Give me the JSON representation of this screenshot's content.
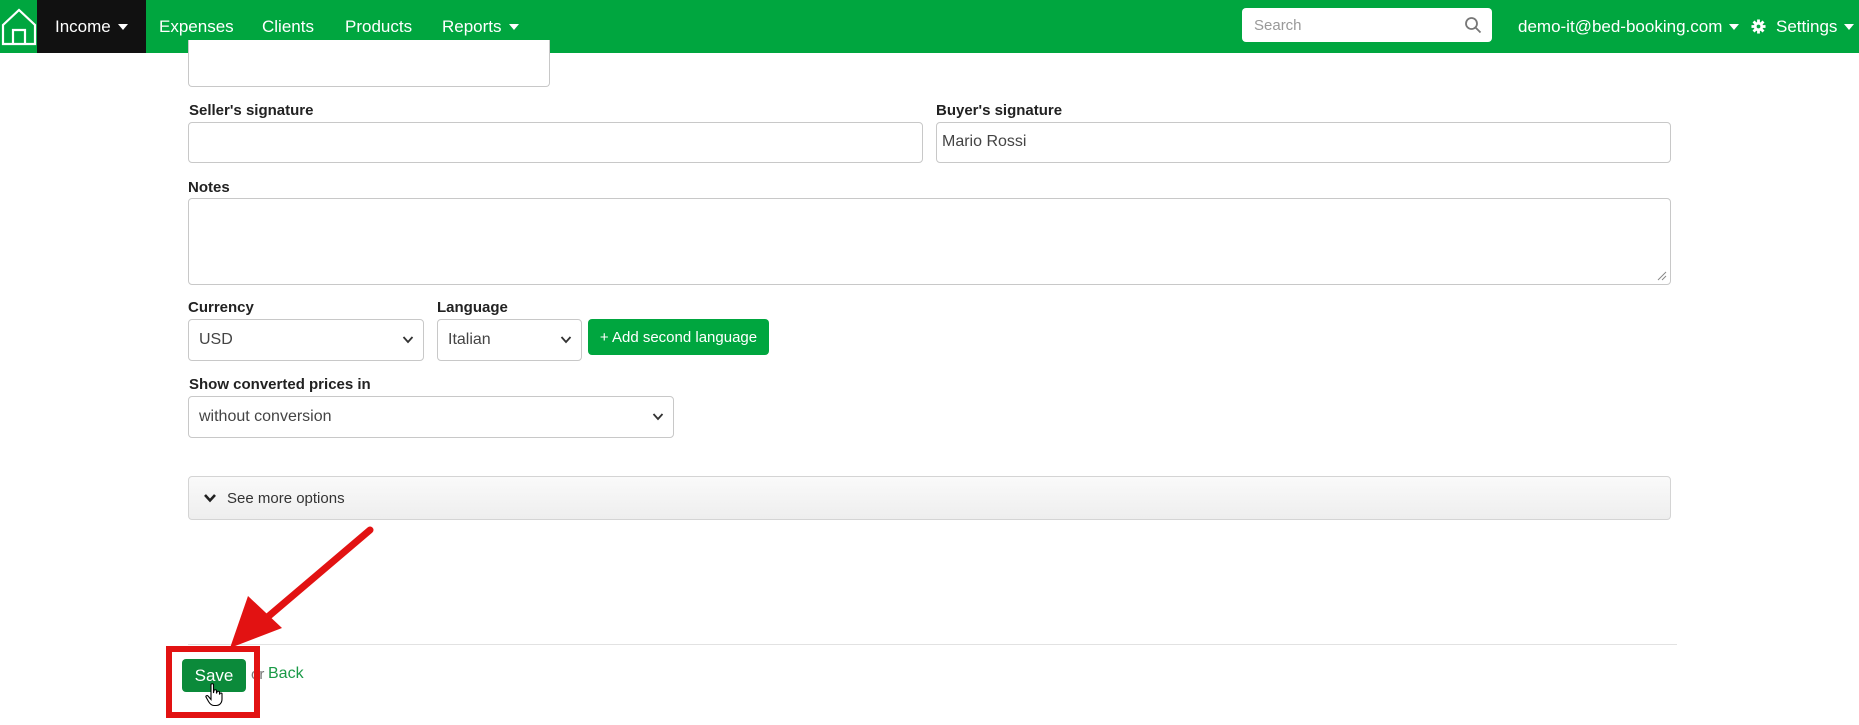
{
  "nav": {
    "home_icon": "home-icon",
    "items": [
      {
        "label": "Income",
        "active": true,
        "dropdown": true
      },
      {
        "label": "Expenses"
      },
      {
        "label": "Clients"
      },
      {
        "label": "Products"
      },
      {
        "label": "Reports",
        "dropdown": true
      }
    ],
    "search_placeholder": "Search",
    "user_email": "demo-it@bed-booking.com",
    "settings_label": "Settings",
    "colors": {
      "bar": "#00a63f",
      "active": "#111111"
    }
  },
  "form": {
    "seller_signature": {
      "label": "Seller's signature",
      "value": ""
    },
    "buyer_signature": {
      "label": "Buyer's signature",
      "value": "Mario Rossi"
    },
    "notes": {
      "label": "Notes",
      "value": ""
    },
    "currency": {
      "label": "Currency",
      "value": "USD"
    },
    "language": {
      "label": "Language",
      "value": "Italian"
    },
    "add_language_button": "+ Add second language",
    "converted_prices": {
      "label": "Show converted prices in",
      "value": "without conversion"
    },
    "more_options_label": "See more options"
  },
  "footer": {
    "save_label": "Save",
    "or_text": "or",
    "back_label": "Back"
  },
  "annotation": {
    "color": "#e21212",
    "target": "save-button"
  }
}
